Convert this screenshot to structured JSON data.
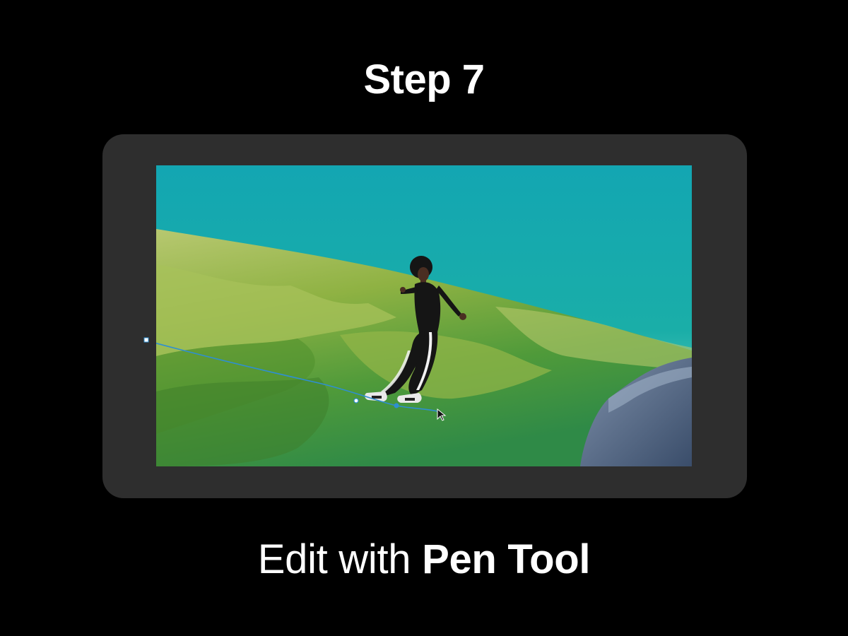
{
  "header": {
    "title": "Step 7"
  },
  "caption": {
    "prefix": "Edit with ",
    "emphasis": "Pen Tool"
  },
  "canvas": {
    "image_icon": "photo-of-woman-walking-over-canyon",
    "tool_icon": "pen-tool-cursor-icon"
  },
  "colors": {
    "background": "#000000",
    "frame": "#2e2e2e",
    "sky": "#1aa7a6",
    "terrain": "#7fae3a",
    "path": "#2f8fd0"
  }
}
